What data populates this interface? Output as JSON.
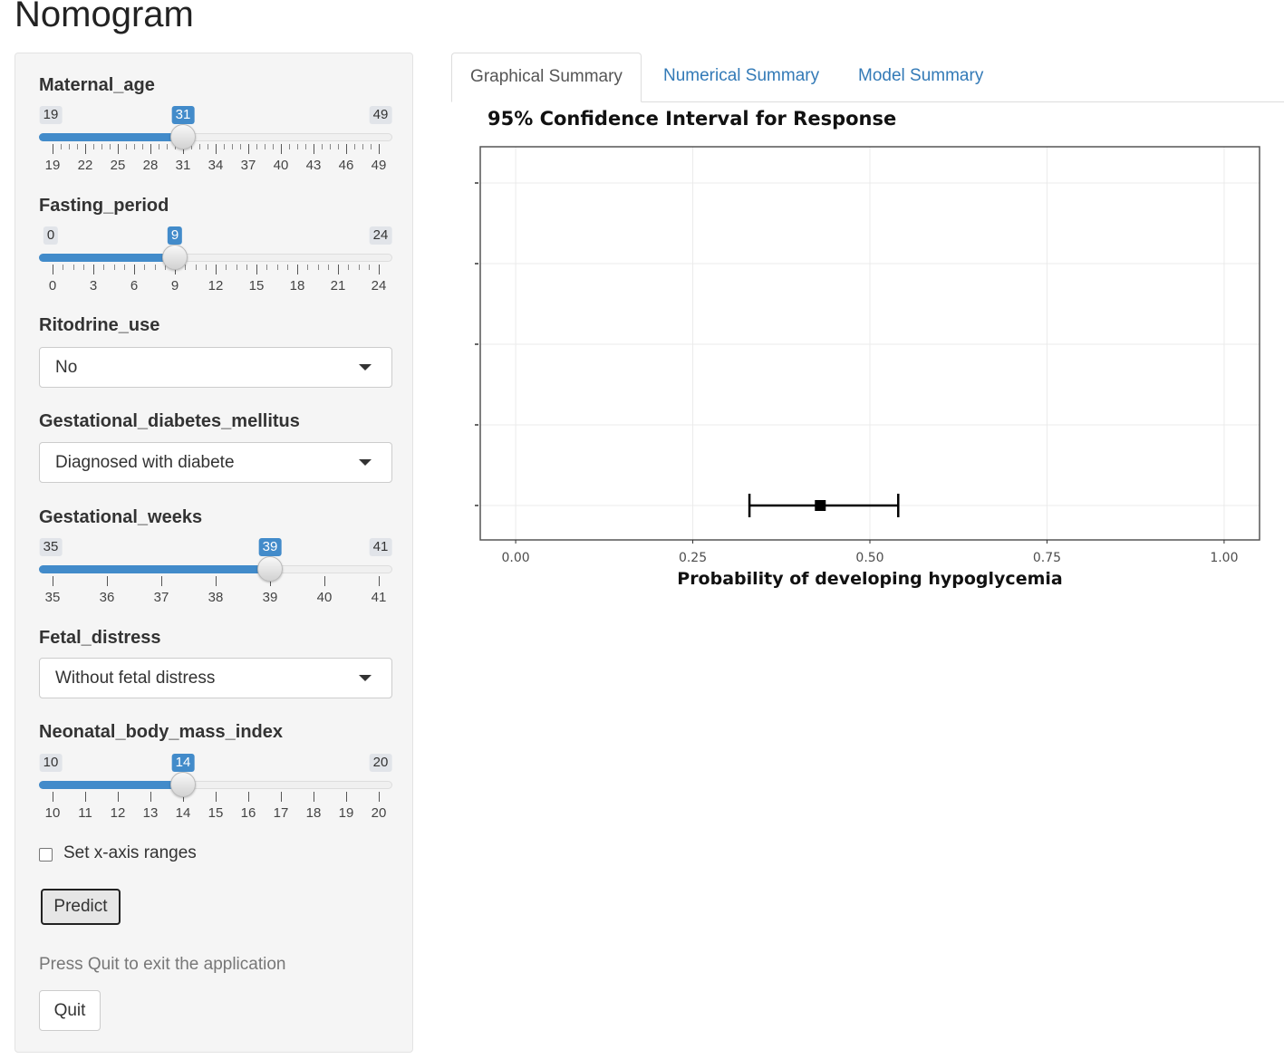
{
  "app": {
    "title": "Nomogram"
  },
  "sidebar": {
    "controls": [
      {
        "label": "Maternal_age",
        "type": "slider",
        "min": 19,
        "max": 49,
        "value": 31,
        "step": 1,
        "ticks": [
          "19",
          "22",
          "25",
          "28",
          "31",
          "34",
          "37",
          "40",
          "43",
          "46",
          "49"
        ]
      },
      {
        "label": "Fasting_period",
        "type": "slider",
        "min": 0,
        "max": 24,
        "value": 9,
        "step": 1,
        "ticks": [
          "0",
          "3",
          "6",
          "9",
          "12",
          "15",
          "18",
          "21",
          "24"
        ]
      },
      {
        "label": "Ritodrine_use",
        "type": "select",
        "value": "No"
      },
      {
        "label": "Gestational_diabetes_mellitus",
        "type": "select",
        "value": "Diagnosed with diabete"
      },
      {
        "label": "Gestational_weeks",
        "type": "slider",
        "min": 35,
        "max": 41,
        "value": 39,
        "step": 1,
        "ticks": [
          "35",
          "36",
          "37",
          "38",
          "39",
          "40",
          "41"
        ]
      },
      {
        "label": "Fetal_distress",
        "type": "select",
        "value": "Without fetal distress"
      },
      {
        "label": "Neonatal_body_mass_index",
        "type": "slider",
        "min": 10,
        "max": 20,
        "value": 14,
        "step": 1,
        "ticks": [
          "10",
          "11",
          "12",
          "13",
          "14",
          "15",
          "16",
          "17",
          "18",
          "19",
          "20"
        ]
      }
    ],
    "xaxis_checkbox": {
      "label": "Set x-axis ranges",
      "checked": false
    },
    "predict_label": "Predict",
    "quit_message": "Press Quit to exit the application",
    "quit_label": "Quit"
  },
  "tabs": [
    {
      "label": "Graphical Summary",
      "active": true
    },
    {
      "label": "Numerical Summary",
      "active": false
    },
    {
      "label": "Model Summary",
      "active": false
    }
  ],
  "chart_data": {
    "type": "scatter",
    "title": "95% Confidence Interval for Response",
    "xlabel": "Probability of developing hypoglycemia",
    "ylabel": "",
    "xlim": [
      -0.05,
      1.05
    ],
    "xticks": [
      "0.00",
      "0.25",
      "0.50",
      "0.75",
      "1.00"
    ],
    "grid": true,
    "y_slots": 5,
    "points": [
      {
        "estimate": 0.43,
        "lower": 0.33,
        "upper": 0.54,
        "slot": 1
      }
    ]
  },
  "colors": {
    "accent": "#428bca",
    "link": "#337ab7"
  }
}
